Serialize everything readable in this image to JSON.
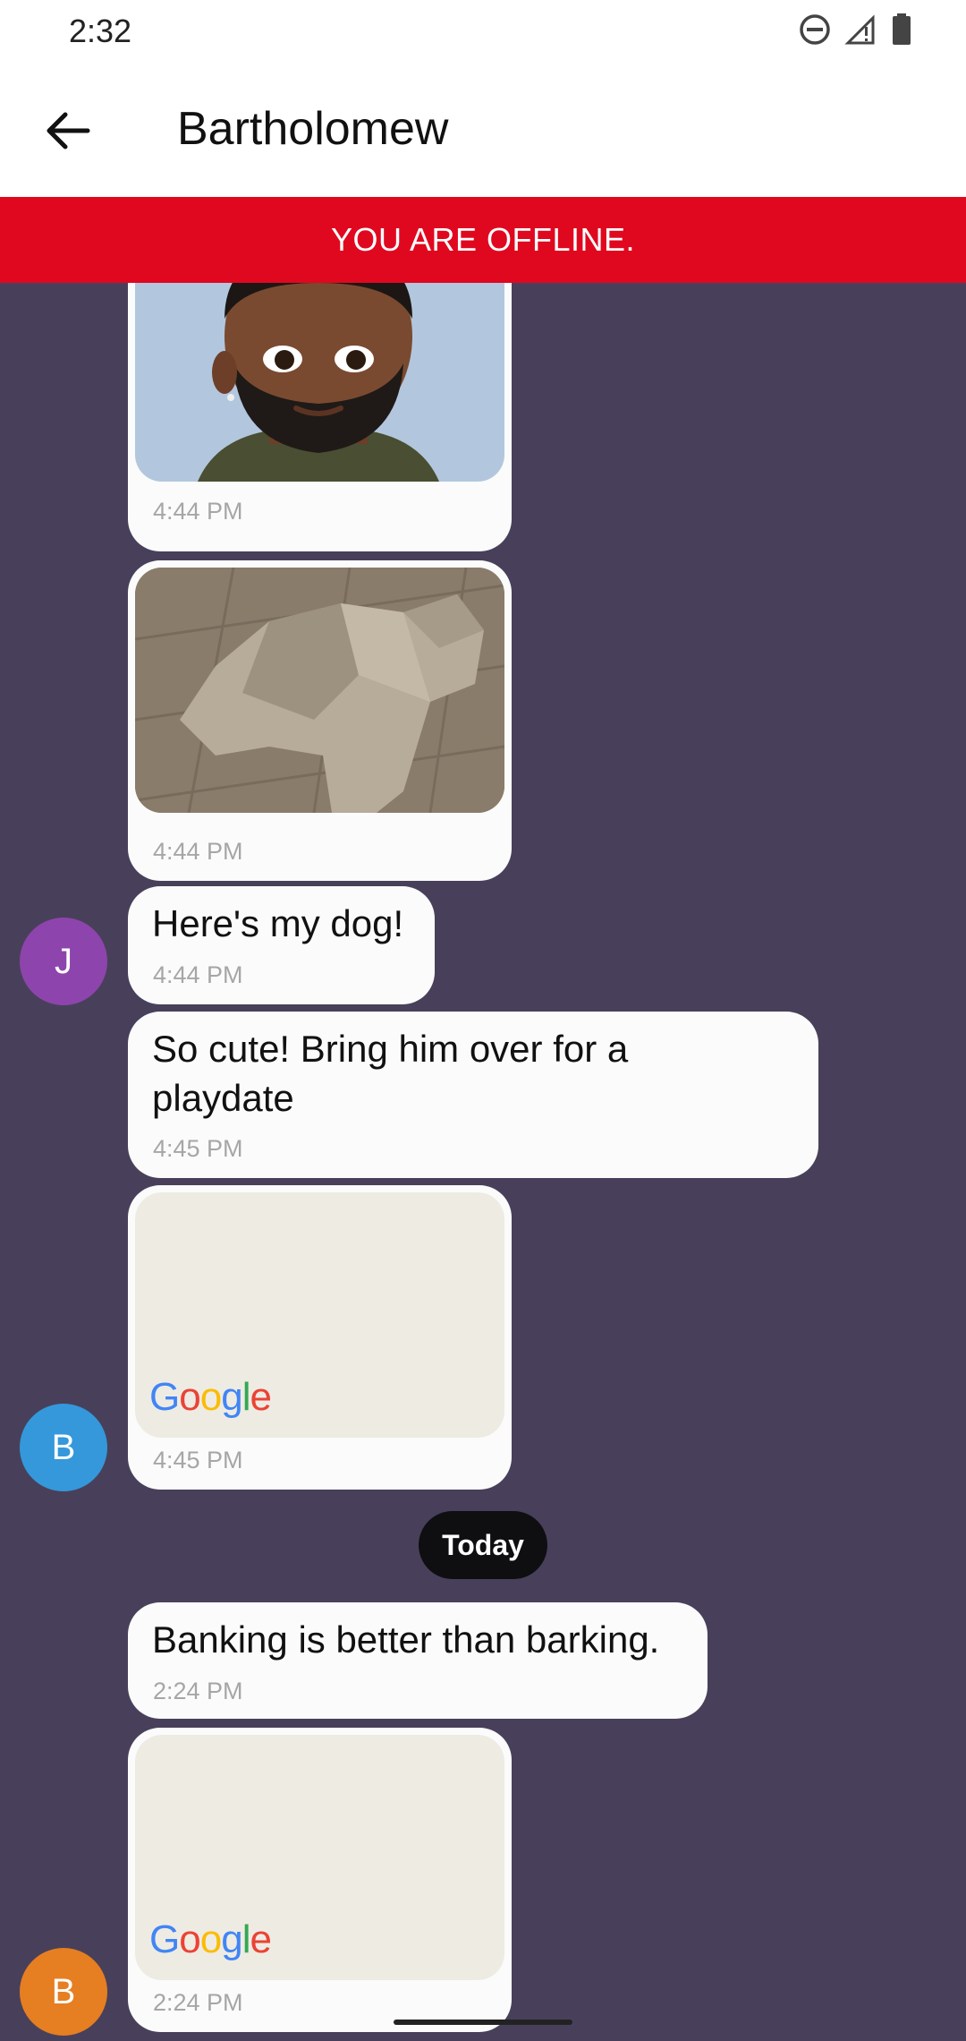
{
  "status_bar": {
    "time": "2:32"
  },
  "header": {
    "title": "Bartholomew"
  },
  "banner": {
    "offline_text": "YOU ARE OFFLINE."
  },
  "messages": [
    {
      "kind": "image",
      "image": "memoji-avatar",
      "time": "4:44 PM"
    },
    {
      "kind": "image",
      "image": "dog-3d-model",
      "time": "4:44 PM"
    },
    {
      "kind": "text",
      "text": "Here's my dog!",
      "time": "4:44 PM",
      "avatar": "J"
    },
    {
      "kind": "text",
      "text": "So cute! Bring him over for a playdate",
      "time": "4:45 PM"
    },
    {
      "kind": "map",
      "map_logo": "Google",
      "time": "4:45 PM",
      "avatar": "B"
    },
    {
      "kind": "text",
      "text": "Banking is better than barking.",
      "time": "2:24 PM"
    },
    {
      "kind": "map",
      "map_logo": "Google",
      "time": "2:24 PM",
      "avatar": "B"
    }
  ],
  "date_divider": {
    "label": "Today"
  },
  "colors": {
    "chat_background": "#48405a",
    "offline_banner": "#e0081f",
    "avatar_j": "#8e44ad",
    "avatar_b_blue": "#3498db",
    "avatar_b_orange": "#e67e22",
    "bubble": "#fbfbfb"
  },
  "icons": [
    "back-arrow-icon",
    "do-not-disturb-icon",
    "signal-icon",
    "battery-icon"
  ]
}
